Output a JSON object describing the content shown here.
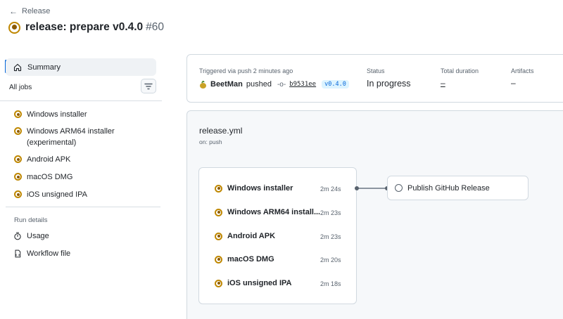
{
  "header": {
    "back_label": "Release",
    "title": "release: prepare v0.4.0",
    "run_number": "#60"
  },
  "sidebar": {
    "summary_label": "Summary",
    "all_jobs_label": "All jobs",
    "jobs": [
      {
        "label": "Windows installer"
      },
      {
        "label": "Windows ARM64 installer (experimental)"
      },
      {
        "label": "Android APK"
      },
      {
        "label": "macOS DMG"
      },
      {
        "label": "iOS unsigned IPA"
      }
    ],
    "run_details_label": "Run details",
    "details": [
      {
        "label": "Usage",
        "icon": "stopwatch-icon"
      },
      {
        "label": "Workflow file",
        "icon": "file-icon"
      }
    ]
  },
  "summary": {
    "trigger_label": "Triggered via push 2 minutes ago",
    "actor": "BeetMan",
    "action": "pushed",
    "sha": "b9531ee",
    "tag": "v0.4.0",
    "status_label": "Status",
    "status_value": "In progress",
    "duration_label": "Total duration",
    "duration_value": "–",
    "artifacts_label": "Artifacts",
    "artifacts_value": "–"
  },
  "graph": {
    "workflow_name": "release.yml",
    "trigger": "on: push",
    "jobs": [
      {
        "label": "Windows installer",
        "duration": "2m 24s"
      },
      {
        "label": "Windows ARM64 install...",
        "duration": "2m 23s"
      },
      {
        "label": "Android APK",
        "duration": "2m 23s"
      },
      {
        "label": "macOS DMG",
        "duration": "2m 20s"
      },
      {
        "label": "iOS unsigned IPA",
        "duration": "2m 18s"
      }
    ],
    "downstream_job": "Publish GitHub Release"
  },
  "colors": {
    "in_progress": "#bf8700",
    "accent": "#0969da"
  }
}
